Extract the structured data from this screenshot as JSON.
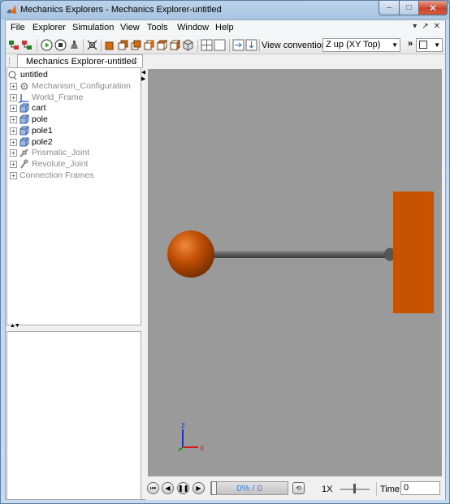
{
  "window": {
    "title": "Mechanics Explorers - Mechanics Explorer-untitled",
    "min_label": "‒",
    "max_label": "□",
    "close_label": "✕"
  },
  "menu": {
    "items": [
      "File",
      "Explorer",
      "Simulation",
      "View",
      "Tools",
      "Window",
      "Help"
    ],
    "mdi_controls": [
      "▾",
      "↗",
      "✕"
    ]
  },
  "toolbar": {
    "view_convention_label": "View convention:",
    "view_convention_value": "Z up (XY Top)",
    "more_label": "»"
  },
  "tab": {
    "label": "Mechanics Explorer-untitled",
    "close_label": "✕"
  },
  "tree": {
    "root_label": "untitled",
    "items": [
      {
        "label": "Mechanism_Configuration",
        "icon": "gear-icon",
        "greyed": true
      },
      {
        "label": "World_Frame",
        "icon": "frame-icon",
        "greyed": true
      },
      {
        "label": "cart",
        "icon": "body-icon",
        "greyed": false
      },
      {
        "label": "pole",
        "icon": "body-icon",
        "greyed": false
      },
      {
        "label": "pole1",
        "icon": "body-icon",
        "greyed": false
      },
      {
        "label": "pole2",
        "icon": "body-icon",
        "greyed": false
      },
      {
        "label": "Prismatic_Joint",
        "icon": "prismatic-joint-icon",
        "greyed": true
      },
      {
        "label": "Revolute_Joint",
        "icon": "revolute-joint-icon",
        "greyed": true
      },
      {
        "label": "Connection Frames",
        "icon": "",
        "greyed": true
      }
    ]
  },
  "scene": {
    "background": "#9a9a9a",
    "ball_color": "#c14f05",
    "cart_color": "#c75200",
    "rod_color": "#5e5e5e",
    "axis_z_label": "z",
    "axis_x_label": "x"
  },
  "playback": {
    "progress_text": "0% / 0",
    "progress_fraction": 0,
    "speed_label": "1X",
    "time_label": "Time",
    "time_value": "0"
  }
}
